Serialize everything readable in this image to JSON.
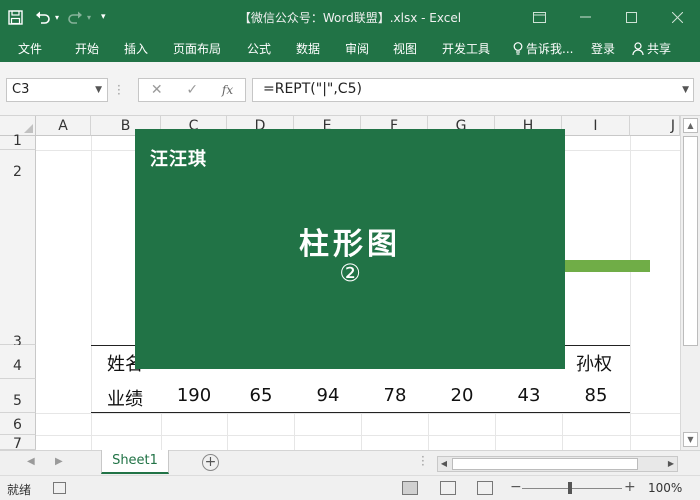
{
  "window": {
    "title": "【微信公众号：Word联盟】.xlsx - Excel",
    "restore_icon": "ribbon-display-icon",
    "min_icon": "minimize-icon",
    "max_icon": "maximize-icon",
    "close_icon": "close-icon"
  },
  "ribbon": {
    "tabs": [
      "文件",
      "开始",
      "插入",
      "页面布局",
      "公式",
      "数据",
      "审阅",
      "视图",
      "开发工具"
    ],
    "tell_me": "告诉我...",
    "login": "登录",
    "share": "共享"
  },
  "formula_bar": {
    "name_box": "C3",
    "formula": "=REPT(\"|\",C5)",
    "fx": "fx"
  },
  "columns": [
    "A",
    "B",
    "C",
    "D",
    "E",
    "F",
    "G",
    "H",
    "I",
    "J"
  ],
  "rows": [
    "1",
    "2",
    "3",
    "4",
    "5",
    "6",
    "7"
  ],
  "cells": {
    "B4": "姓名",
    "I4": "孙权",
    "B5": "业绩",
    "values": [
      "190",
      "65",
      "94",
      "78",
      "20",
      "43",
      "85"
    ]
  },
  "overlay": {
    "brand": "汪汪琪",
    "title": "柱形图",
    "subtitle": "②"
  },
  "sheets": {
    "active": "Sheet1"
  },
  "status": {
    "ready": "就绪",
    "zoom": "100%"
  }
}
